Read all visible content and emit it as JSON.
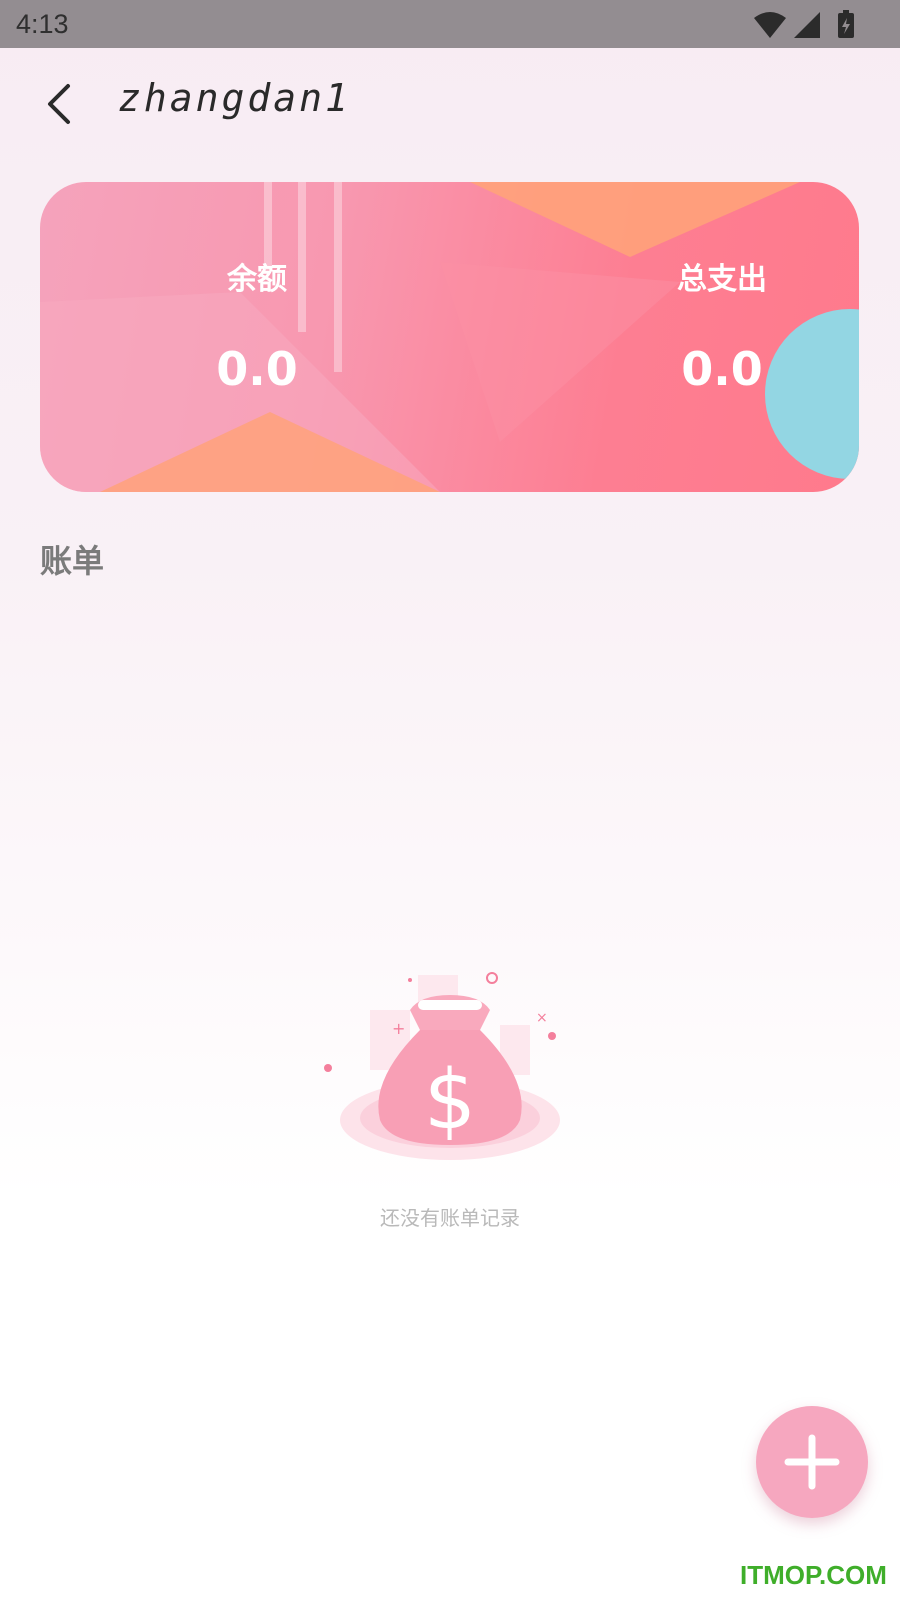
{
  "status_bar": {
    "time": "4:13",
    "icons": [
      "wifi-icon",
      "cellular-signal-icon",
      "battery-charging-icon"
    ]
  },
  "app_bar": {
    "back_icon": "chevron-left-icon",
    "title": "zhangdan1"
  },
  "summary_card": {
    "balance_label": "余额",
    "balance_value": "0.0",
    "expense_label": "总支出",
    "expense_value": "0.0"
  },
  "bills_section": {
    "title": "账单"
  },
  "empty_state": {
    "illustration": "money-bag-icon",
    "message": "还没有账单记录"
  },
  "fab": {
    "icon": "plus-icon"
  },
  "watermark": "ITMOP.COM",
  "colors": {
    "accent_pink": "#f6a7bf",
    "card_gradient_start": "#f5a3bc",
    "card_gradient_end": "#ff7a8c",
    "card_orange": "#ffa27a",
    "card_teal": "#93d6e3"
  }
}
